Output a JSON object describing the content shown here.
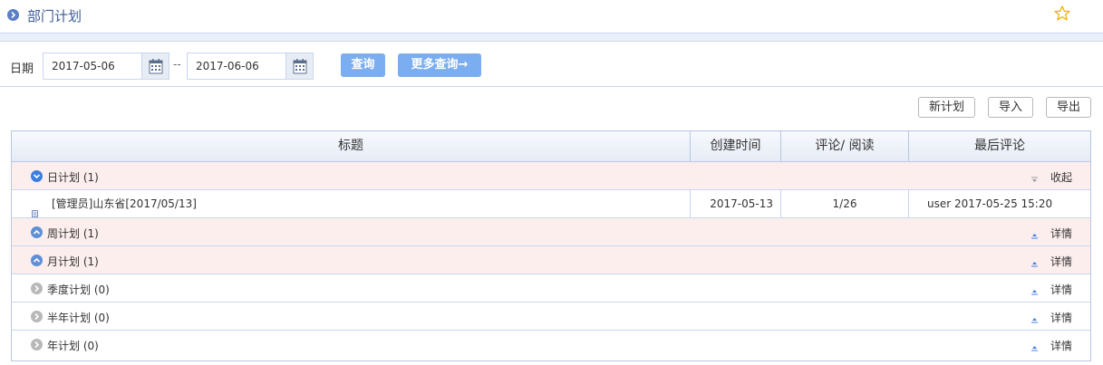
{
  "header": {
    "title": "部门计划",
    "nav_icon": "chevron-right-circle-icon",
    "fav_icon": "star-icon"
  },
  "filter": {
    "date_label": "日期",
    "start_date": "2017-05-06",
    "end_date": "2017-06-06",
    "separator": "--",
    "query_label": "查询",
    "more_query_label": "更多查询→"
  },
  "actions": {
    "new_plan": "新计划",
    "import": "导入",
    "export": "导出"
  },
  "table": {
    "columns": [
      "标题",
      "创建时间",
      "评论/ 阅读",
      "最后评论"
    ],
    "groups": [
      {
        "label": "日计划 (1)",
        "toggle": "收起",
        "state": "expanded"
      },
      {
        "label": "周计划 (1)",
        "toggle": "详情",
        "state": "collapsed"
      },
      {
        "label": "月计划 (1)",
        "toggle": "详情",
        "state": "collapsed"
      },
      {
        "label": "季度计划 (0)",
        "toggle": "详情",
        "state": "empty"
      },
      {
        "label": "半年计划 (0)",
        "toggle": "详情",
        "state": "empty"
      },
      {
        "label": "年计划 (0)",
        "toggle": "详情",
        "state": "empty"
      }
    ],
    "rows": [
      {
        "title": "[管理员]山东省[2017/05/13]",
        "created": "2017-05-13",
        "comments_reads": "1/26",
        "last_comment": "user 2017-05-25 15:20"
      }
    ]
  },
  "colors": {
    "accent": "#7aaef0",
    "title": "#3c5a97",
    "group_bg": "#fdeeee",
    "star": "#f0b400"
  }
}
